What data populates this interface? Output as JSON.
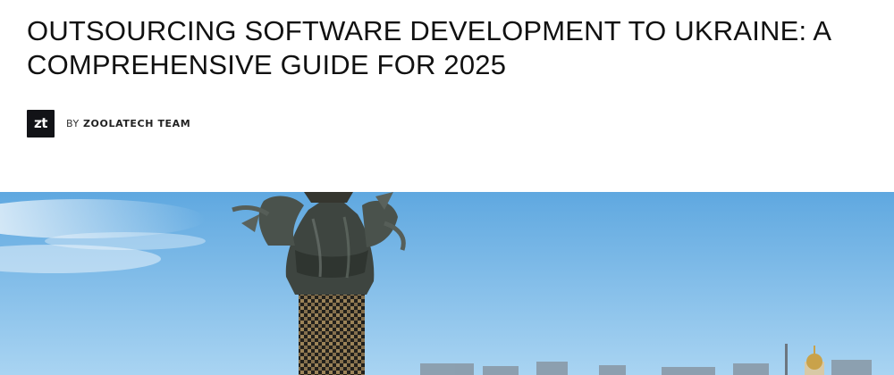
{
  "article": {
    "title": "OUTSOURCING SOFTWARE DEVELOPMENT TO UKRAINE: A COMPREHENSIVE GUIDE FOR 2025",
    "byline_prefix": "BY",
    "author": "ZOOLATECH TEAM",
    "author_logo_text": "zt"
  },
  "hero_image": {
    "subject": "independence-monument-statue",
    "sky_color": "#7bb8e6"
  }
}
